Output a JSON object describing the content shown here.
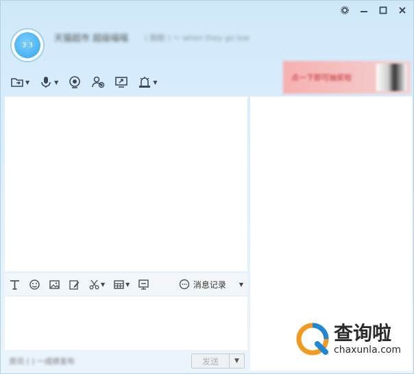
{
  "window": {
    "controls": [
      "settings",
      "minimize",
      "maximize",
      "close"
    ]
  },
  "header": {
    "avatar_text": "3 3",
    "contact_name": "天猫超市 超级喵喵",
    "signature": "( 酷酷 ) ～ when they go low"
  },
  "toolbar": {
    "items": [
      {
        "name": "file-transfer",
        "icon": "folder-icon",
        "has_menu": true
      },
      {
        "name": "voice-call",
        "icon": "microphone-icon",
        "has_menu": true
      },
      {
        "name": "video-call",
        "icon": "camera-icon",
        "has_menu": false
      },
      {
        "name": "add-friend",
        "icon": "add-person-icon",
        "has_menu": false
      },
      {
        "name": "screen-share",
        "icon": "screen-share-icon",
        "has_menu": false
      },
      {
        "name": "remote-assist",
        "icon": "alarm-icon",
        "has_menu": true
      }
    ]
  },
  "ad": {
    "text": "点一下即可抽奖啦"
  },
  "input_toolbar": {
    "history_label": "消息记录"
  },
  "bottom": {
    "status_text": "资讯 ( ) 一成绩发布",
    "send_label": "发送"
  },
  "watermark": {
    "cn": "查询啦",
    "en": "chaxunla.com"
  },
  "colors": {
    "accent": "#2ea4ee",
    "watermark_orange": "#f29a1f",
    "watermark_blue": "#1e88d6"
  }
}
